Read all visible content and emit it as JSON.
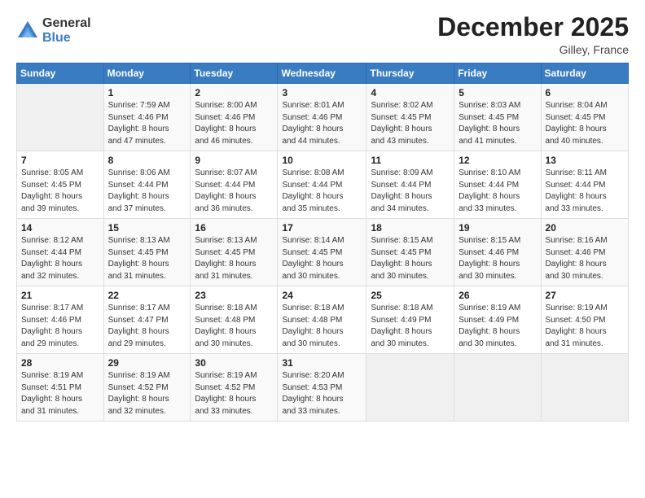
{
  "header": {
    "logo_general": "General",
    "logo_blue": "Blue",
    "month_title": "December 2025",
    "location": "Gilley, France"
  },
  "weekdays": [
    "Sunday",
    "Monday",
    "Tuesday",
    "Wednesday",
    "Thursday",
    "Friday",
    "Saturday"
  ],
  "weeks": [
    [
      {
        "day": "",
        "sunrise": "",
        "sunset": "",
        "daylight": ""
      },
      {
        "day": "1",
        "sunrise": "Sunrise: 7:59 AM",
        "sunset": "Sunset: 4:46 PM",
        "daylight": "Daylight: 8 hours and 47 minutes."
      },
      {
        "day": "2",
        "sunrise": "Sunrise: 8:00 AM",
        "sunset": "Sunset: 4:46 PM",
        "daylight": "Daylight: 8 hours and 46 minutes."
      },
      {
        "day": "3",
        "sunrise": "Sunrise: 8:01 AM",
        "sunset": "Sunset: 4:46 PM",
        "daylight": "Daylight: 8 hours and 44 minutes."
      },
      {
        "day": "4",
        "sunrise": "Sunrise: 8:02 AM",
        "sunset": "Sunset: 4:45 PM",
        "daylight": "Daylight: 8 hours and 43 minutes."
      },
      {
        "day": "5",
        "sunrise": "Sunrise: 8:03 AM",
        "sunset": "Sunset: 4:45 PM",
        "daylight": "Daylight: 8 hours and 41 minutes."
      },
      {
        "day": "6",
        "sunrise": "Sunrise: 8:04 AM",
        "sunset": "Sunset: 4:45 PM",
        "daylight": "Daylight: 8 hours and 40 minutes."
      }
    ],
    [
      {
        "day": "7",
        "sunrise": "Sunrise: 8:05 AM",
        "sunset": "Sunset: 4:45 PM",
        "daylight": "Daylight: 8 hours and 39 minutes."
      },
      {
        "day": "8",
        "sunrise": "Sunrise: 8:06 AM",
        "sunset": "Sunset: 4:44 PM",
        "daylight": "Daylight: 8 hours and 37 minutes."
      },
      {
        "day": "9",
        "sunrise": "Sunrise: 8:07 AM",
        "sunset": "Sunset: 4:44 PM",
        "daylight": "Daylight: 8 hours and 36 minutes."
      },
      {
        "day": "10",
        "sunrise": "Sunrise: 8:08 AM",
        "sunset": "Sunset: 4:44 PM",
        "daylight": "Daylight: 8 hours and 35 minutes."
      },
      {
        "day": "11",
        "sunrise": "Sunrise: 8:09 AM",
        "sunset": "Sunset: 4:44 PM",
        "daylight": "Daylight: 8 hours and 34 minutes."
      },
      {
        "day": "12",
        "sunrise": "Sunrise: 8:10 AM",
        "sunset": "Sunset: 4:44 PM",
        "daylight": "Daylight: 8 hours and 33 minutes."
      },
      {
        "day": "13",
        "sunrise": "Sunrise: 8:11 AM",
        "sunset": "Sunset: 4:44 PM",
        "daylight": "Daylight: 8 hours and 33 minutes."
      }
    ],
    [
      {
        "day": "14",
        "sunrise": "Sunrise: 8:12 AM",
        "sunset": "Sunset: 4:44 PM",
        "daylight": "Daylight: 8 hours and 32 minutes."
      },
      {
        "day": "15",
        "sunrise": "Sunrise: 8:13 AM",
        "sunset": "Sunset: 4:45 PM",
        "daylight": "Daylight: 8 hours and 31 minutes."
      },
      {
        "day": "16",
        "sunrise": "Sunrise: 8:13 AM",
        "sunset": "Sunset: 4:45 PM",
        "daylight": "Daylight: 8 hours and 31 minutes."
      },
      {
        "day": "17",
        "sunrise": "Sunrise: 8:14 AM",
        "sunset": "Sunset: 4:45 PM",
        "daylight": "Daylight: 8 hours and 30 minutes."
      },
      {
        "day": "18",
        "sunrise": "Sunrise: 8:15 AM",
        "sunset": "Sunset: 4:45 PM",
        "daylight": "Daylight: 8 hours and 30 minutes."
      },
      {
        "day": "19",
        "sunrise": "Sunrise: 8:15 AM",
        "sunset": "Sunset: 4:46 PM",
        "daylight": "Daylight: 8 hours and 30 minutes."
      },
      {
        "day": "20",
        "sunrise": "Sunrise: 8:16 AM",
        "sunset": "Sunset: 4:46 PM",
        "daylight": "Daylight: 8 hours and 30 minutes."
      }
    ],
    [
      {
        "day": "21",
        "sunrise": "Sunrise: 8:17 AM",
        "sunset": "Sunset: 4:46 PM",
        "daylight": "Daylight: 8 hours and 29 minutes."
      },
      {
        "day": "22",
        "sunrise": "Sunrise: 8:17 AM",
        "sunset": "Sunset: 4:47 PM",
        "daylight": "Daylight: 8 hours and 29 minutes."
      },
      {
        "day": "23",
        "sunrise": "Sunrise: 8:18 AM",
        "sunset": "Sunset: 4:48 PM",
        "daylight": "Daylight: 8 hours and 30 minutes."
      },
      {
        "day": "24",
        "sunrise": "Sunrise: 8:18 AM",
        "sunset": "Sunset: 4:48 PM",
        "daylight": "Daylight: 8 hours and 30 minutes."
      },
      {
        "day": "25",
        "sunrise": "Sunrise: 8:18 AM",
        "sunset": "Sunset: 4:49 PM",
        "daylight": "Daylight: 8 hours and 30 minutes."
      },
      {
        "day": "26",
        "sunrise": "Sunrise: 8:19 AM",
        "sunset": "Sunset: 4:49 PM",
        "daylight": "Daylight: 8 hours and 30 minutes."
      },
      {
        "day": "27",
        "sunrise": "Sunrise: 8:19 AM",
        "sunset": "Sunset: 4:50 PM",
        "daylight": "Daylight: 8 hours and 31 minutes."
      }
    ],
    [
      {
        "day": "28",
        "sunrise": "Sunrise: 8:19 AM",
        "sunset": "Sunset: 4:51 PM",
        "daylight": "Daylight: 8 hours and 31 minutes."
      },
      {
        "day": "29",
        "sunrise": "Sunrise: 8:19 AM",
        "sunset": "Sunset: 4:52 PM",
        "daylight": "Daylight: 8 hours and 32 minutes."
      },
      {
        "day": "30",
        "sunrise": "Sunrise: 8:19 AM",
        "sunset": "Sunset: 4:52 PM",
        "daylight": "Daylight: 8 hours and 33 minutes."
      },
      {
        "day": "31",
        "sunrise": "Sunrise: 8:20 AM",
        "sunset": "Sunset: 4:53 PM",
        "daylight": "Daylight: 8 hours and 33 minutes."
      },
      {
        "day": "",
        "sunrise": "",
        "sunset": "",
        "daylight": ""
      },
      {
        "day": "",
        "sunrise": "",
        "sunset": "",
        "daylight": ""
      },
      {
        "day": "",
        "sunrise": "",
        "sunset": "",
        "daylight": ""
      }
    ]
  ]
}
